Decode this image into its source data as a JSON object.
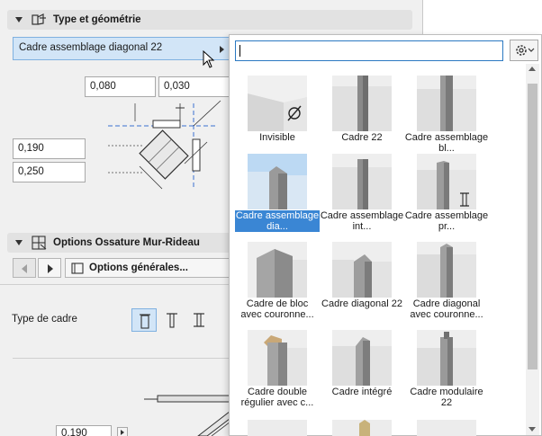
{
  "section_type": {
    "title": "Type et géométrie"
  },
  "profile_selector": {
    "value": "Cadre assemblage diagonal 22"
  },
  "dimensions": {
    "top_left": "0,080",
    "top_right": "0,030",
    "side_1": "0,190",
    "side_2": "0,250",
    "bottom": "0,190"
  },
  "section_options": {
    "title": "Options Ossature Mur-Rideau",
    "dropdown": "Options générales...",
    "frame_type_label": "Type de cadre"
  },
  "popup": {
    "search_value": "",
    "items": [
      {
        "label": "Invisible"
      },
      {
        "label": "Cadre 22"
      },
      {
        "label": "Cadre assemblage bl..."
      },
      {
        "label": "Cadre assemblage dia...",
        "selected": true
      },
      {
        "label": "Cadre assemblage int..."
      },
      {
        "label": "Cadre assemblage pr..."
      },
      {
        "label": "Cadre de bloc avec couronne..."
      },
      {
        "label": "Cadre diagonal 22"
      },
      {
        "label": "Cadre diagonal avec couronne..."
      },
      {
        "label": "Cadre double régulier avec c..."
      },
      {
        "label": "Cadre intégré"
      },
      {
        "label": "Cadre modulaire 22"
      }
    ]
  },
  "colors": {
    "selection_blue": "#3a86d4",
    "selector_bg": "#d2e5f7",
    "panel_bg": "#f0f0f0"
  }
}
